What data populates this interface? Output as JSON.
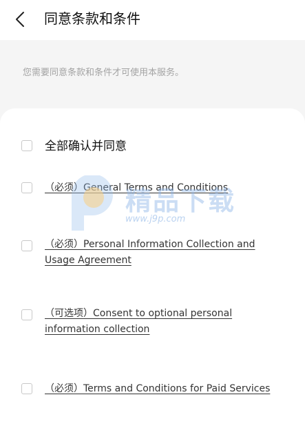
{
  "header": {
    "title": "同意条款和条件",
    "back_icon": "chevron-left-icon"
  },
  "note": "您需要同意条款和条件才可使用本服务。",
  "agree_all": {
    "label": "全部确认并同意",
    "checked": false
  },
  "terms": [
    {
      "label": "（必须）General Terms and Conditions",
      "checked": false
    },
    {
      "label": "（必须）Personal Information Collection and Usage Agreement",
      "checked": false
    },
    {
      "label": "（可选项）Consent to optional personal information collection",
      "checked": false
    },
    {
      "label": "（必须）Terms and Conditions for Paid Services",
      "checked": false
    }
  ],
  "watermark": {
    "text": "精品下载",
    "url": "www.j9p.com"
  },
  "colors": {
    "background": "#f5f5f5",
    "card": "#ffffff",
    "note_text": "#a3a3a3",
    "checkbox_border": "#c8c8c8"
  }
}
